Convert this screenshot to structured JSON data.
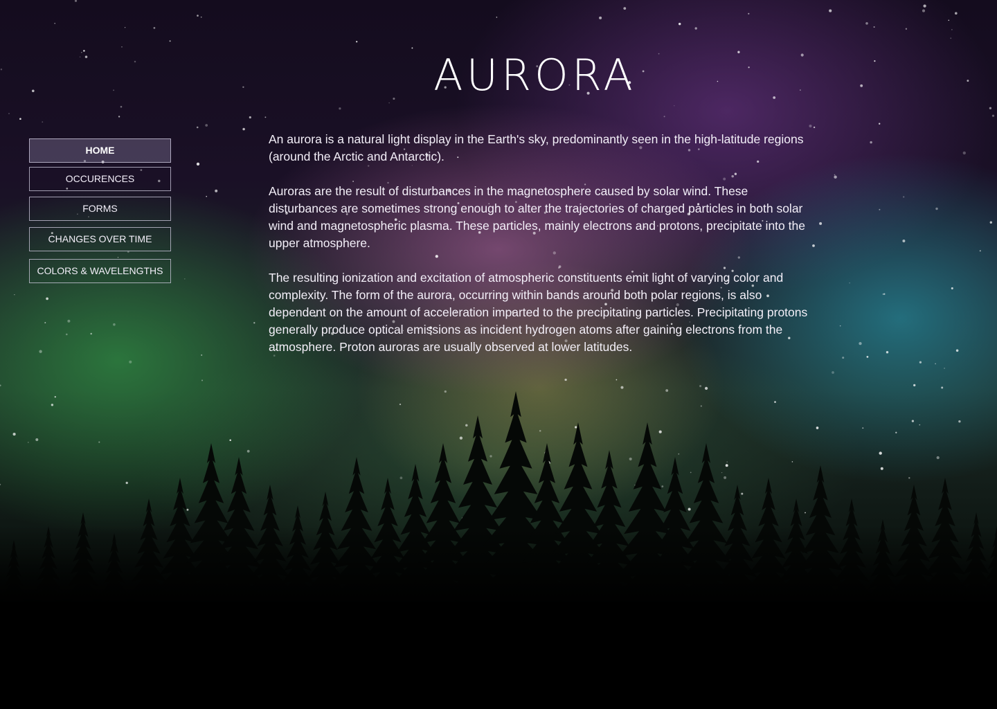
{
  "page": {
    "title": "AURORA"
  },
  "nav": {
    "items": [
      {
        "label": "HOME",
        "active": true
      },
      {
        "label": "OCCURENCES",
        "active": false
      },
      {
        "label": "FORMS",
        "active": false
      },
      {
        "label": "CHANGES OVER TIME",
        "active": false
      },
      {
        "label": "COLORS & WAVELENGTHS",
        "active": false
      }
    ]
  },
  "content": {
    "paragraphs": [
      "An aurora is a natural light display in the Earth's sky, predominantly seen in the high-latitude regions (around the Arctic and Antarctic).",
      "Auroras are the result of disturbances in the magnetosphere caused by solar wind. These disturbances are sometimes strong enough to alter the trajectories of charged particles in both solar wind and magnetospheric plasma. These particles, mainly electrons and protons, precipitate into the upper atmosphere.",
      "The resulting ionization and excitation of atmospheric constituents emit light of varying color and complexity. The form of the aurora, occurring within bands around both polar regions, is also dependent on the amount of acceleration imparted to the precipitating particles. Precipitating protons generally produce optical emissions as incident hydrogen atoms after gaining electrons from the atmosphere. Proton auroras are usually observed at lower latitudes."
    ]
  },
  "colors": {
    "text": "#f3eff8",
    "nav_border": "#d2cde1",
    "nav_active_bg": "#968caf",
    "aurora_green": "#329646",
    "aurora_purple": "#783c96",
    "aurora_teal": "#2896aa"
  }
}
